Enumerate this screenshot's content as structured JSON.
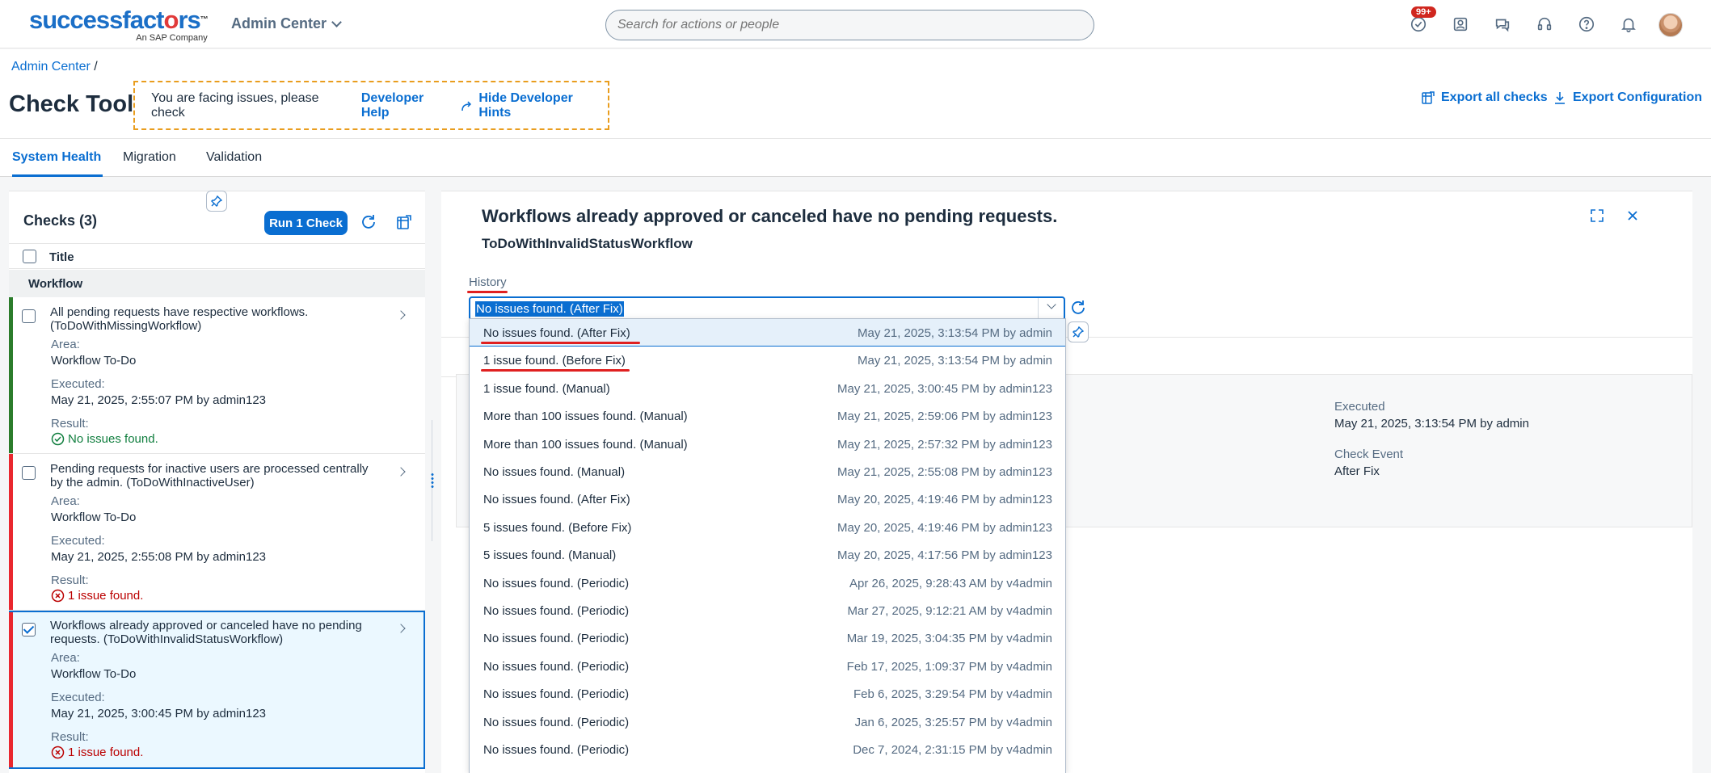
{
  "shell": {
    "logo_word": "successfactors",
    "logo_tagline": "An SAP Company",
    "app_menu": "Admin Center",
    "search_placeholder": "Search for actions or people",
    "notification_badge": "99+"
  },
  "header": {
    "breadcrumb_root": "Admin Center",
    "breadcrumb_sep": "/",
    "title": "Check Tool",
    "hint_text": "You are facing issues, please check",
    "hint_link": "Developer Help",
    "hint_hide": "Hide Developer Hints",
    "export_all": "Export all checks",
    "export_config": "Export Configuration"
  },
  "tabs": [
    {
      "label": "System Health"
    },
    {
      "label": "Migration"
    },
    {
      "label": "Validation"
    }
  ],
  "checks": {
    "heading": "Checks (3)",
    "run_label": "Run 1 Check",
    "col_title": "Title",
    "group": "Workflow",
    "area_label": "Area:",
    "executed_label": "Executed:",
    "result_label": "Result:",
    "items": [
      {
        "title": "All pending requests have respective workflows. (ToDoWithMissingWorkflow)",
        "area": "Workflow To-Do",
        "executed": "May 21, 2025, 2:55:07 PM by admin123",
        "result": "No issues found.",
        "status_color": "#2b7c2b"
      },
      {
        "title": "Pending requests for inactive users are processed centrally by the admin. (ToDoWithInactiveUser)",
        "area": "Workflow To-Do",
        "executed": "May 21, 2025, 2:55:08 PM by admin123",
        "result": "1 issue found.",
        "status_color": "#e9272e"
      },
      {
        "title": "Workflows already approved or canceled have no pending requests. (ToDoWithInvalidStatusWorkflow)",
        "area": "Workflow To-Do",
        "executed": "May 21, 2025, 3:00:45 PM by admin123",
        "result": "1 issue found.",
        "status_color": "#e9272e"
      }
    ]
  },
  "detail": {
    "title": "Workflows already approved or canceled have no pending requests.",
    "subtitle": "ToDoWithInvalidStatusWorkflow",
    "history_label": "History",
    "selected_value": "No issues found. (After Fix)",
    "executed_label": "Executed",
    "executed_value": "May 21, 2025, 3:13:54 PM by admin",
    "event_label": "Check Event",
    "event_value": "After Fix"
  },
  "history_options": [
    {
      "label": "No issues found. (After Fix)",
      "when": "May 21, 2025, 3:13:54 PM by admin"
    },
    {
      "label": "1 issue found. (Before Fix)",
      "when": "May 21, 2025, 3:13:54 PM by admin"
    },
    {
      "label": "1 issue found. (Manual)",
      "when": "May 21, 2025, 3:00:45 PM by admin123"
    },
    {
      "label": "More than 100 issues found. (Manual)",
      "when": "May 21, 2025, 2:59:06 PM by admin123"
    },
    {
      "label": "More than 100 issues found. (Manual)",
      "when": "May 21, 2025, 2:57:32 PM by admin123"
    },
    {
      "label": "No issues found. (Manual)",
      "when": "May 21, 2025, 2:55:08 PM by admin123"
    },
    {
      "label": "No issues found. (After Fix)",
      "when": "May 20, 2025, 4:19:46 PM by admin123"
    },
    {
      "label": "5 issues found. (Before Fix)",
      "when": "May 20, 2025, 4:19:46 PM by admin123"
    },
    {
      "label": "5 issues found. (Manual)",
      "when": "May 20, 2025, 4:17:56 PM by admin123"
    },
    {
      "label": "No issues found. (Periodic)",
      "when": "Apr 26, 2025, 9:28:43 AM by v4admin"
    },
    {
      "label": "No issues found. (Periodic)",
      "when": "Mar 27, 2025, 9:12:21 AM by v4admin"
    },
    {
      "label": "No issues found. (Periodic)",
      "when": "Mar 19, 2025, 3:04:35 PM by v4admin"
    },
    {
      "label": "No issues found. (Periodic)",
      "when": "Feb 17, 2025, 1:09:37 PM by v4admin"
    },
    {
      "label": "No issues found. (Periodic)",
      "when": "Feb 6, 2025, 3:29:54 PM by v4admin"
    },
    {
      "label": "No issues found. (Periodic)",
      "when": "Jan 6, 2025, 3:25:57 PM by v4admin"
    },
    {
      "label": "No issues found. (Periodic)",
      "when": "Dec 7, 2024, 2:31:15 PM by v4admin"
    }
  ],
  "colors": {
    "accent": "#0a6ed1",
    "success": "#107e3e",
    "error": "#bb0000",
    "hint_border": "#e99d1e"
  }
}
